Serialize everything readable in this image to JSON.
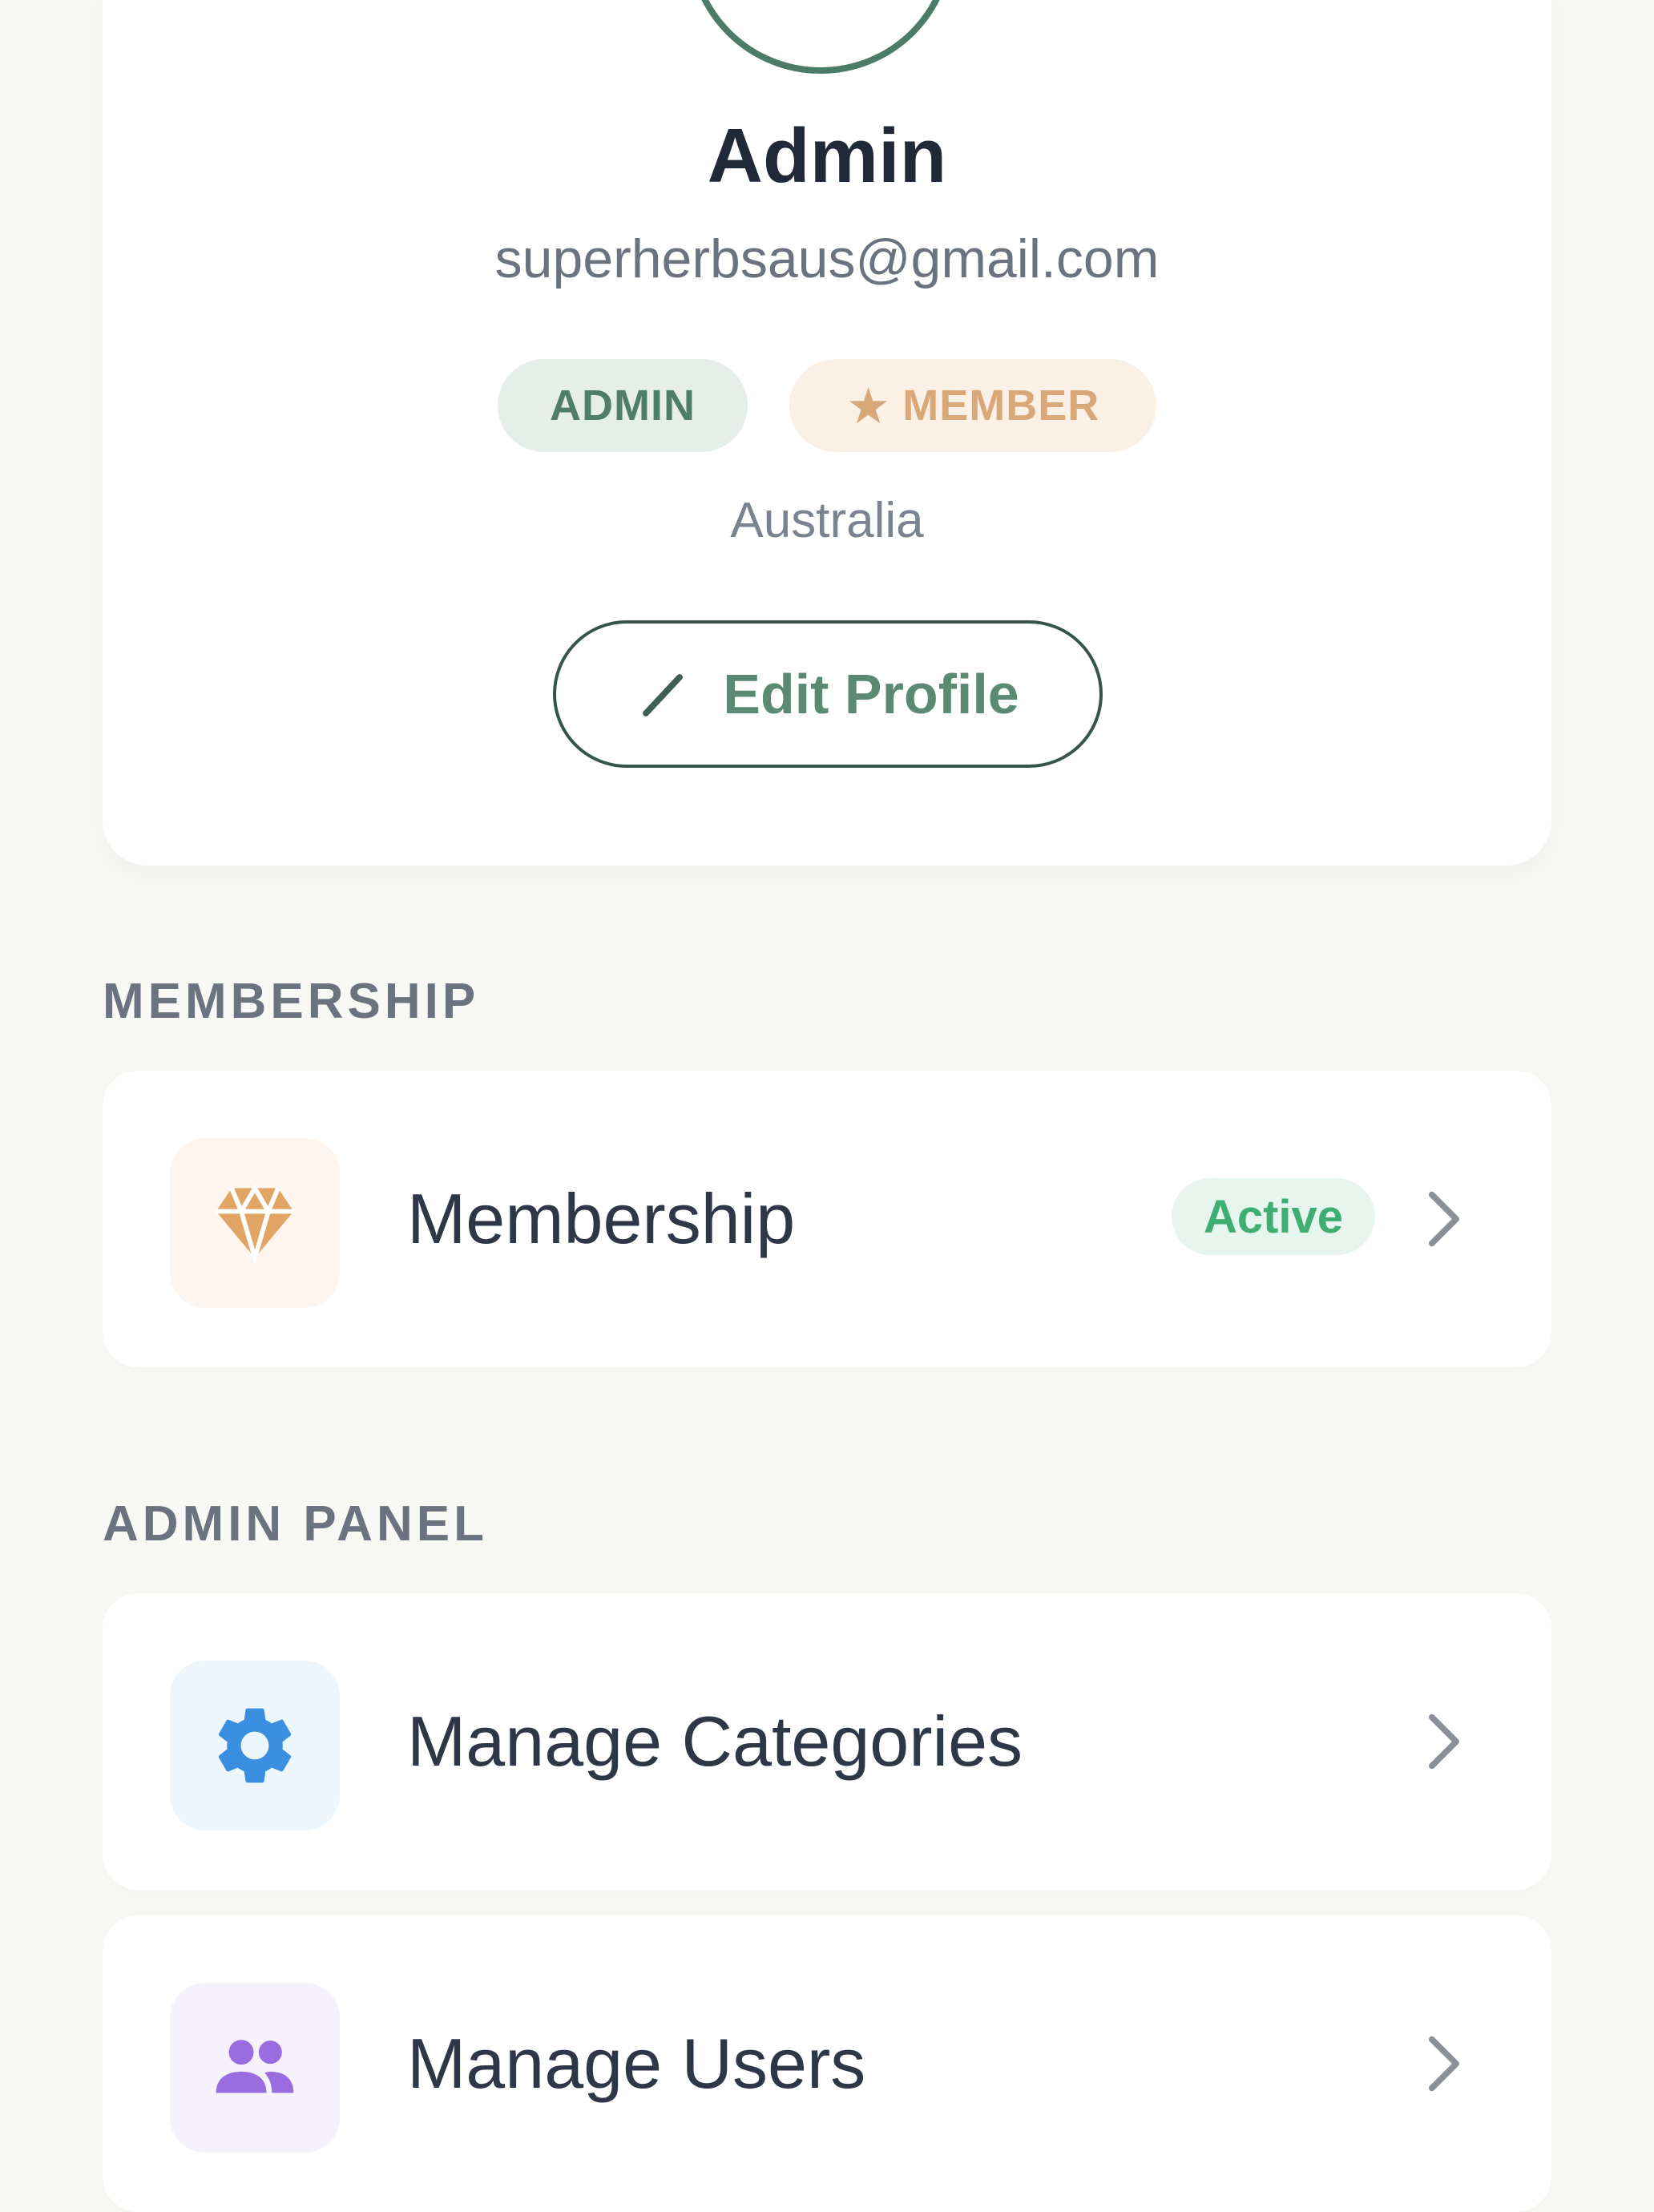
{
  "profile": {
    "name": "Admin",
    "email": "superherbsaus@gmail.com",
    "badges": {
      "role": "ADMIN",
      "member": "MEMBER"
    },
    "country": "Australia",
    "edit_button_label": "Edit Profile"
  },
  "sections": {
    "membership": {
      "title": "MEMBERSHIP",
      "items": [
        {
          "label": "Membership",
          "status": "Active",
          "icon": "diamond-icon"
        }
      ]
    },
    "admin_panel": {
      "title": "ADMIN PANEL",
      "items": [
        {
          "label": "Manage Categories",
          "icon": "gear-icon"
        },
        {
          "label": "Manage Users",
          "icon": "users-icon"
        }
      ]
    }
  },
  "colors": {
    "background": "#f8f8f4",
    "brand_green": "#4a7c68",
    "member_accent": "#d9a878",
    "status_active": "#3fae73",
    "categories_icon": "#3b8fe0",
    "users_icon": "#9b6ce0"
  }
}
